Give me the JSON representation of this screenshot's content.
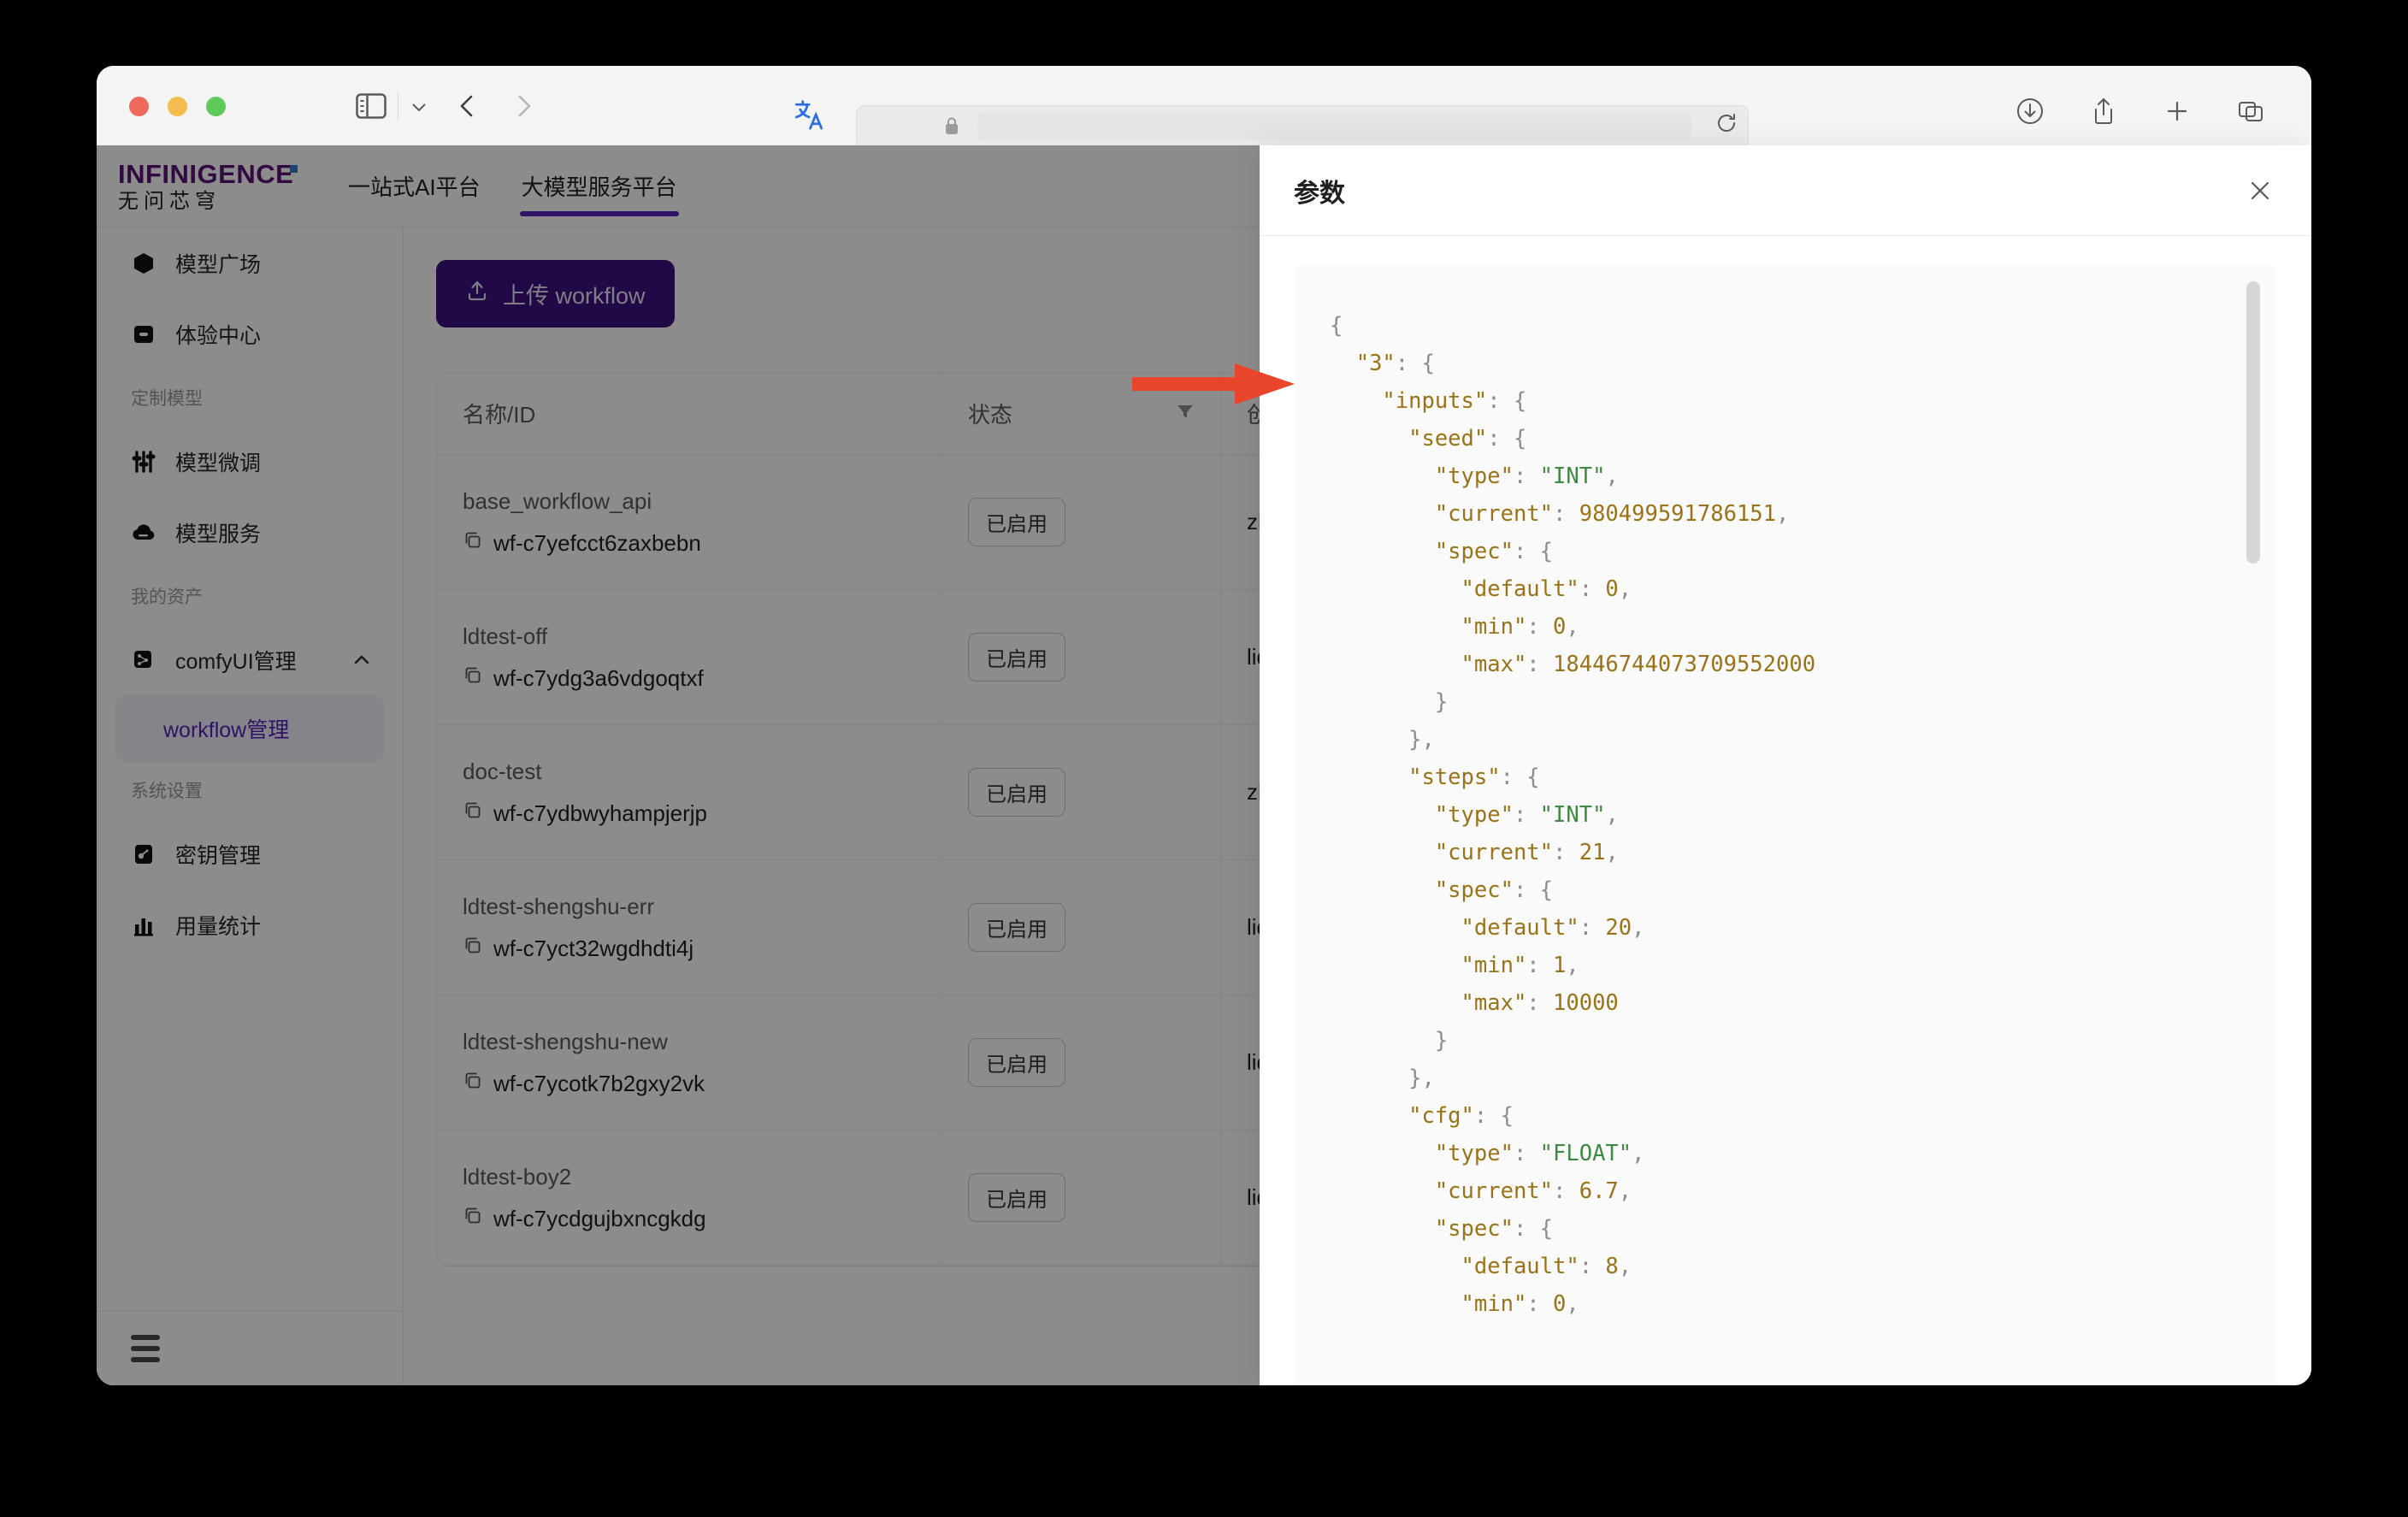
{
  "browser": {
    "traffic_lights": [
      "close",
      "minimize",
      "zoom"
    ],
    "sidebar_toggle_icon": "sidebar-icon",
    "dropdown_icon": "chevron-down-icon",
    "back_icon": "chevron-left-icon",
    "forward_icon": "chevron-right-icon",
    "translate_icon": "translate-icon",
    "translate_label": "中A",
    "lock_icon": "lock-icon",
    "url_value": "",
    "url_placeholder": "",
    "reload_icon": "reload-icon",
    "right_icons": [
      "download-icon",
      "share-icon",
      "new-tab-icon",
      "tab-overview-icon"
    ]
  },
  "site": {
    "brand_main": "INFINIGENCE",
    "brand_sub": "无问芯穹",
    "nav": [
      {
        "label": "一站式AI平台",
        "active": false
      },
      {
        "label": "大模型服务平台",
        "active": true
      }
    ]
  },
  "sidebar": {
    "items": [
      {
        "label": "模型广场",
        "icon": "cube-icon",
        "type": "item"
      },
      {
        "label": "体验中心",
        "icon": "card-icon",
        "type": "item"
      },
      {
        "label": "定制模型",
        "type": "group"
      },
      {
        "label": "模型微调",
        "icon": "sliders-icon",
        "type": "item"
      },
      {
        "label": "模型服务",
        "icon": "cloud-icon",
        "type": "item"
      },
      {
        "label": "我的资产",
        "type": "group"
      },
      {
        "label": "comfyUI管理",
        "icon": "flow-icon",
        "type": "expandable",
        "expanded": true,
        "chevron": "chevron-up-icon"
      },
      {
        "label": "workflow管理",
        "type": "subitem",
        "active": true
      },
      {
        "label": "系统设置",
        "type": "group"
      },
      {
        "label": "密钥管理",
        "icon": "key-icon",
        "type": "item"
      },
      {
        "label": "用量统计",
        "icon": "chart-icon",
        "type": "item"
      }
    ],
    "collapse_icon": "hamburger-icon",
    "active_color": "#5b21b6"
  },
  "main": {
    "upload_button": {
      "label": "上传 workflow",
      "icon": "upload-icon",
      "color": "#3d1080"
    },
    "table": {
      "columns": [
        {
          "label": "名称/ID",
          "filter": false
        },
        {
          "label": "状态",
          "filter": true,
          "filter_icon": "filter-icon"
        },
        {
          "label": "创建者",
          "filter": false
        }
      ],
      "rows": [
        {
          "name": "base_workflow_api",
          "id": "wf-c7yefcct6zaxbebn",
          "status": "已启用",
          "creator": "zhaoy"
        },
        {
          "name": "ldtest-off",
          "id": "wf-c7ydg3a6vdgoqtxf",
          "status": "已启用",
          "creator": "liduo"
        },
        {
          "name": "doc-test",
          "id": "wf-c7ydbwyhampjerjp",
          "status": "已启用",
          "creator": "zhaoy"
        },
        {
          "name": "ldtest-shengshu-err",
          "id": "wf-c7yct32wgdhdti4j",
          "status": "已启用",
          "creator": "liduo"
        },
        {
          "name": "ldtest-shengshu-new",
          "id": "wf-c7ycotk7b2gxy2vk",
          "status": "已启用",
          "creator": "liduo"
        },
        {
          "name": "ldtest-boy2",
          "id": "wf-c7ycdgujbxncgkdg",
          "status": "已启用",
          "creator": "liduo"
        }
      ],
      "copy_icon": "copy-icon"
    }
  },
  "drawer": {
    "title": "参数",
    "close_icon": "close-icon",
    "json_tokens": [
      {
        "t": "{",
        "c": "p"
      },
      {
        "t": "\n  ",
        "c": "p"
      },
      {
        "t": "\"3\"",
        "c": "k"
      },
      {
        "t": ": {",
        "c": "p"
      },
      {
        "t": "\n    ",
        "c": "p"
      },
      {
        "t": "\"inputs\"",
        "c": "k"
      },
      {
        "t": ": {",
        "c": "p"
      },
      {
        "t": "\n      ",
        "c": "p"
      },
      {
        "t": "\"seed\"",
        "c": "k"
      },
      {
        "t": ": {",
        "c": "p"
      },
      {
        "t": "\n        ",
        "c": "p"
      },
      {
        "t": "\"type\"",
        "c": "k"
      },
      {
        "t": ": ",
        "c": "p"
      },
      {
        "t": "\"INT\"",
        "c": "s"
      },
      {
        "t": ",",
        "c": "p"
      },
      {
        "t": "\n        ",
        "c": "p"
      },
      {
        "t": "\"current\"",
        "c": "k"
      },
      {
        "t": ": ",
        "c": "p"
      },
      {
        "t": "980499591786151",
        "c": "n"
      },
      {
        "t": ",",
        "c": "p"
      },
      {
        "t": "\n        ",
        "c": "p"
      },
      {
        "t": "\"spec\"",
        "c": "k"
      },
      {
        "t": ": {",
        "c": "p"
      },
      {
        "t": "\n          ",
        "c": "p"
      },
      {
        "t": "\"default\"",
        "c": "k"
      },
      {
        "t": ": ",
        "c": "p"
      },
      {
        "t": "0",
        "c": "n"
      },
      {
        "t": ",",
        "c": "p"
      },
      {
        "t": "\n          ",
        "c": "p"
      },
      {
        "t": "\"min\"",
        "c": "k"
      },
      {
        "t": ": ",
        "c": "p"
      },
      {
        "t": "0",
        "c": "n"
      },
      {
        "t": ",",
        "c": "p"
      },
      {
        "t": "\n          ",
        "c": "p"
      },
      {
        "t": "\"max\"",
        "c": "k"
      },
      {
        "t": ": ",
        "c": "p"
      },
      {
        "t": "18446744073709552000",
        "c": "n"
      },
      {
        "t": "\n        }",
        "c": "p"
      },
      {
        "t": "\n      },",
        "c": "p"
      },
      {
        "t": "\n      ",
        "c": "p"
      },
      {
        "t": "\"steps\"",
        "c": "k"
      },
      {
        "t": ": {",
        "c": "p"
      },
      {
        "t": "\n        ",
        "c": "p"
      },
      {
        "t": "\"type\"",
        "c": "k"
      },
      {
        "t": ": ",
        "c": "p"
      },
      {
        "t": "\"INT\"",
        "c": "s"
      },
      {
        "t": ",",
        "c": "p"
      },
      {
        "t": "\n        ",
        "c": "p"
      },
      {
        "t": "\"current\"",
        "c": "k"
      },
      {
        "t": ": ",
        "c": "p"
      },
      {
        "t": "21",
        "c": "n"
      },
      {
        "t": ",",
        "c": "p"
      },
      {
        "t": "\n        ",
        "c": "p"
      },
      {
        "t": "\"spec\"",
        "c": "k"
      },
      {
        "t": ": {",
        "c": "p"
      },
      {
        "t": "\n          ",
        "c": "p"
      },
      {
        "t": "\"default\"",
        "c": "k"
      },
      {
        "t": ": ",
        "c": "p"
      },
      {
        "t": "20",
        "c": "n"
      },
      {
        "t": ",",
        "c": "p"
      },
      {
        "t": "\n          ",
        "c": "p"
      },
      {
        "t": "\"min\"",
        "c": "k"
      },
      {
        "t": ": ",
        "c": "p"
      },
      {
        "t": "1",
        "c": "n"
      },
      {
        "t": ",",
        "c": "p"
      },
      {
        "t": "\n          ",
        "c": "p"
      },
      {
        "t": "\"max\"",
        "c": "k"
      },
      {
        "t": ": ",
        "c": "p"
      },
      {
        "t": "10000",
        "c": "n"
      },
      {
        "t": "\n        }",
        "c": "p"
      },
      {
        "t": "\n      },",
        "c": "p"
      },
      {
        "t": "\n      ",
        "c": "p"
      },
      {
        "t": "\"cfg\"",
        "c": "k"
      },
      {
        "t": ": {",
        "c": "p"
      },
      {
        "t": "\n        ",
        "c": "p"
      },
      {
        "t": "\"type\"",
        "c": "k"
      },
      {
        "t": ": ",
        "c": "p"
      },
      {
        "t": "\"FLOAT\"",
        "c": "s"
      },
      {
        "t": ",",
        "c": "p"
      },
      {
        "t": "\n        ",
        "c": "p"
      },
      {
        "t": "\"current\"",
        "c": "k"
      },
      {
        "t": ": ",
        "c": "p"
      },
      {
        "t": "6.7",
        "c": "n"
      },
      {
        "t": ",",
        "c": "p"
      },
      {
        "t": "\n        ",
        "c": "p"
      },
      {
        "t": "\"spec\"",
        "c": "k"
      },
      {
        "t": ": {",
        "c": "p"
      },
      {
        "t": "\n          ",
        "c": "p"
      },
      {
        "t": "\"default\"",
        "c": "k"
      },
      {
        "t": ": ",
        "c": "p"
      },
      {
        "t": "8",
        "c": "n"
      },
      {
        "t": ",",
        "c": "p"
      },
      {
        "t": "\n          ",
        "c": "p"
      },
      {
        "t": "\"min\"",
        "c": "k"
      },
      {
        "t": ": ",
        "c": "p"
      },
      {
        "t": "0",
        "c": "n"
      },
      {
        "t": ",",
        "c": "p"
      }
    ]
  },
  "annotation": {
    "type": "arrow",
    "direction": "right",
    "color": "#e8452a"
  }
}
